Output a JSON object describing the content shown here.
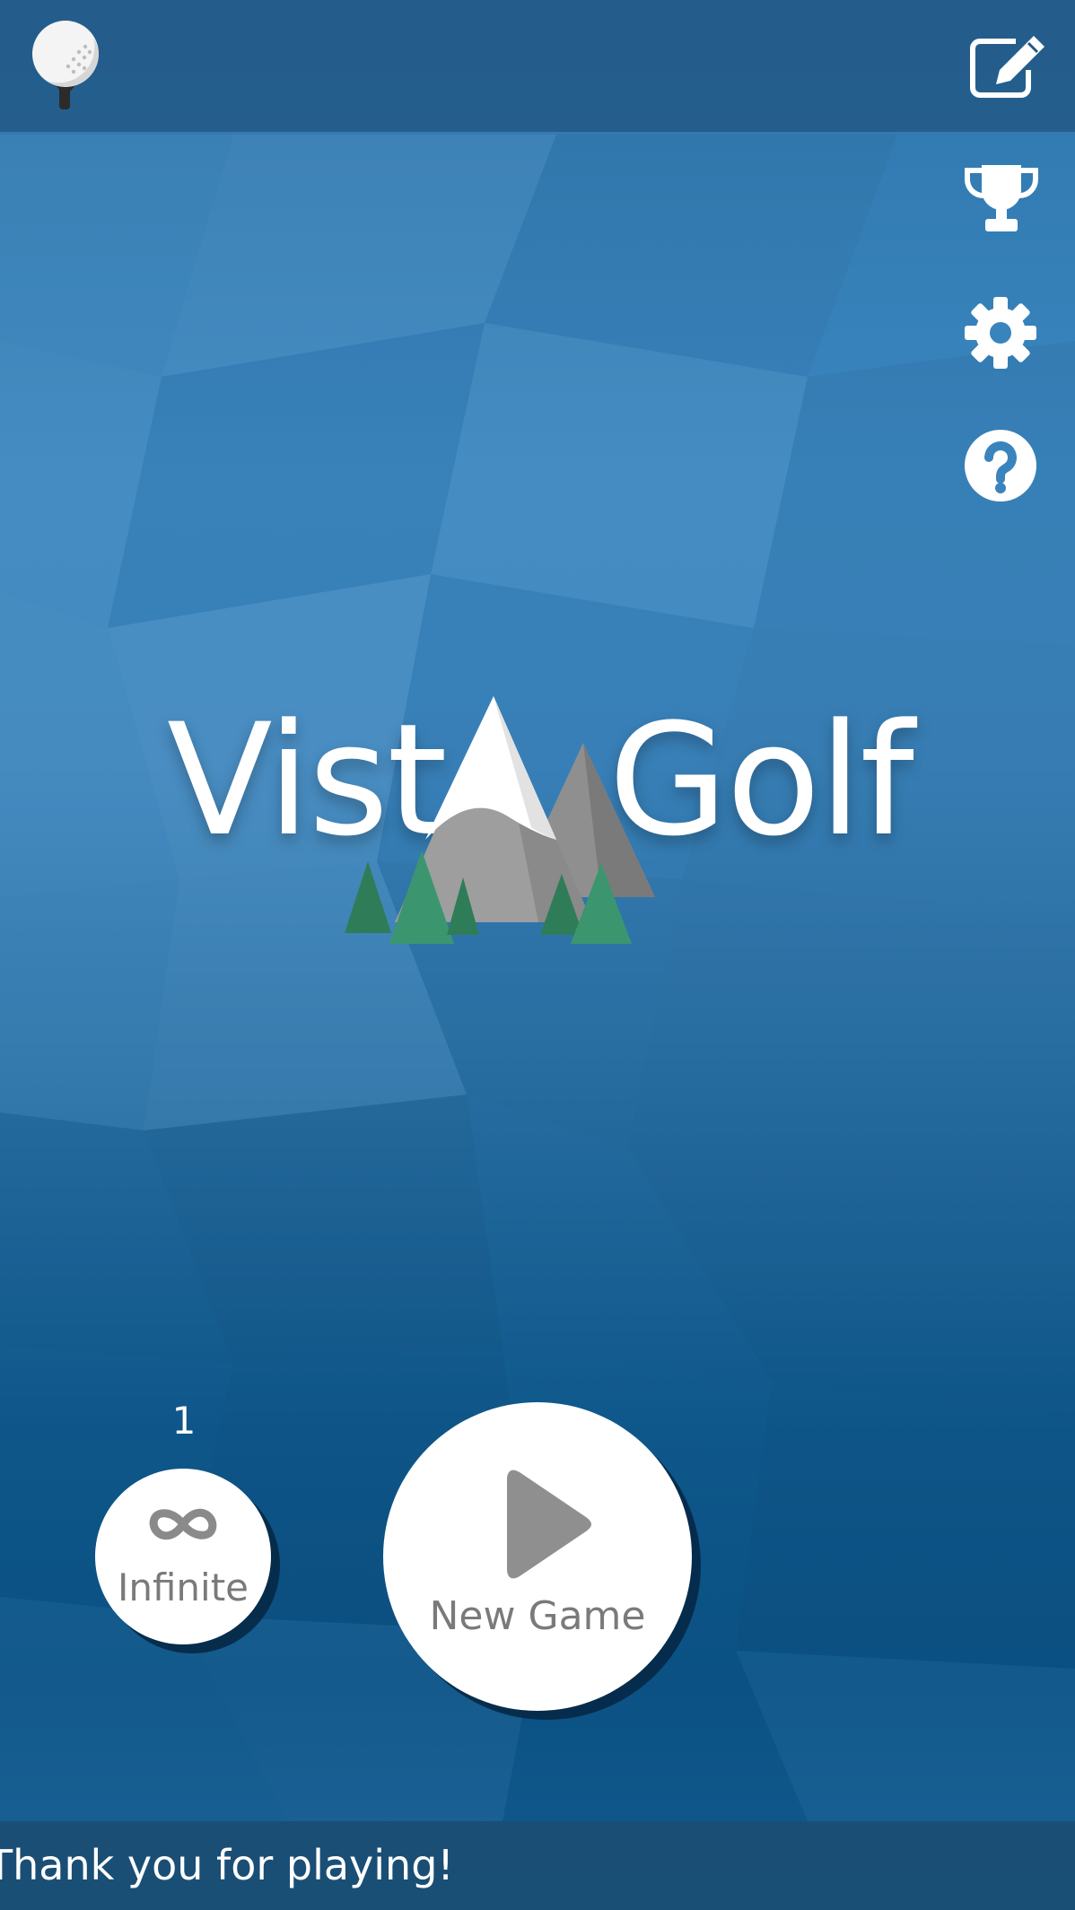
{
  "app": {
    "title_left": "Vist",
    "title_right": "Golf"
  },
  "top_bar": {
    "left_icon": "golf-ball-on-tee-icon",
    "right_icon": "edit-icon"
  },
  "side_menu": {
    "items": [
      {
        "icon": "trophy-icon"
      },
      {
        "icon": "gear-icon"
      },
      {
        "icon": "help-icon"
      }
    ]
  },
  "infinite_mode": {
    "count": "1",
    "symbol": "∞",
    "label": "Infinite"
  },
  "new_game": {
    "icon": "play-icon",
    "label": "New Game"
  },
  "footer": {
    "ticker_text": "Thank you for playing!"
  },
  "colors": {
    "background": "#2f79b0",
    "bar": "#245680",
    "button_face": "#ffffff",
    "button_text": "#7a7a7a",
    "tree_green": "#3a8f68",
    "mountain_grey": "#9a9a9a"
  }
}
